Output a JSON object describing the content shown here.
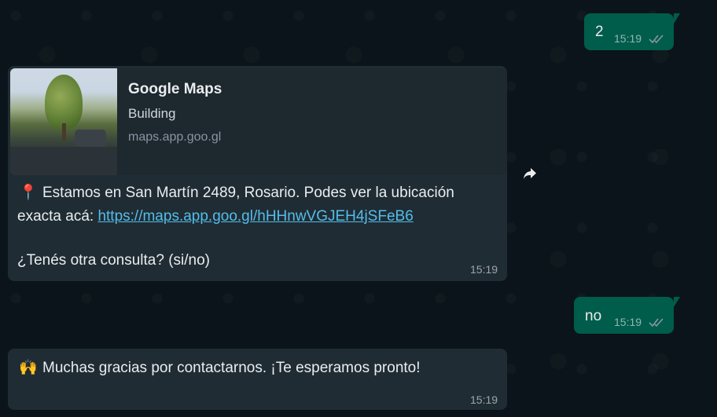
{
  "messages": {
    "m1": {
      "text": "2",
      "time": "15:19"
    },
    "m2": {
      "preview": {
        "title": "Google Maps",
        "subtitle": "Building",
        "url": "maps.app.goo.gl"
      },
      "pin_emoji": "📍",
      "line1": "Estamos en San Martín 2489, Rosario. Podes ver la ubicación",
      "line2_prefix": "exacta acá: ",
      "link": "https://maps.app.goo.gl/hHHnwVGJEH4jSFeB6",
      "question": "¿Tenés otra consulta? (si/no)",
      "time": "15:19"
    },
    "m3": {
      "text": "no",
      "time": "15:19"
    },
    "m4": {
      "emoji": "🙌",
      "text": "Muchas gracias por contactarnos. ¡Te esperamos pronto!",
      "time": "15:19"
    }
  },
  "icons": {
    "forward": "forward-arrow-icon",
    "read_receipt": "double-check-icon",
    "thumbnail": "map-thumbnail"
  },
  "colors": {
    "background": "#0b141a",
    "outgoing_bubble": "#005c4b",
    "incoming_bubble": "#202c33",
    "link": "#53bdeb",
    "read_tick": "#8696a0"
  }
}
